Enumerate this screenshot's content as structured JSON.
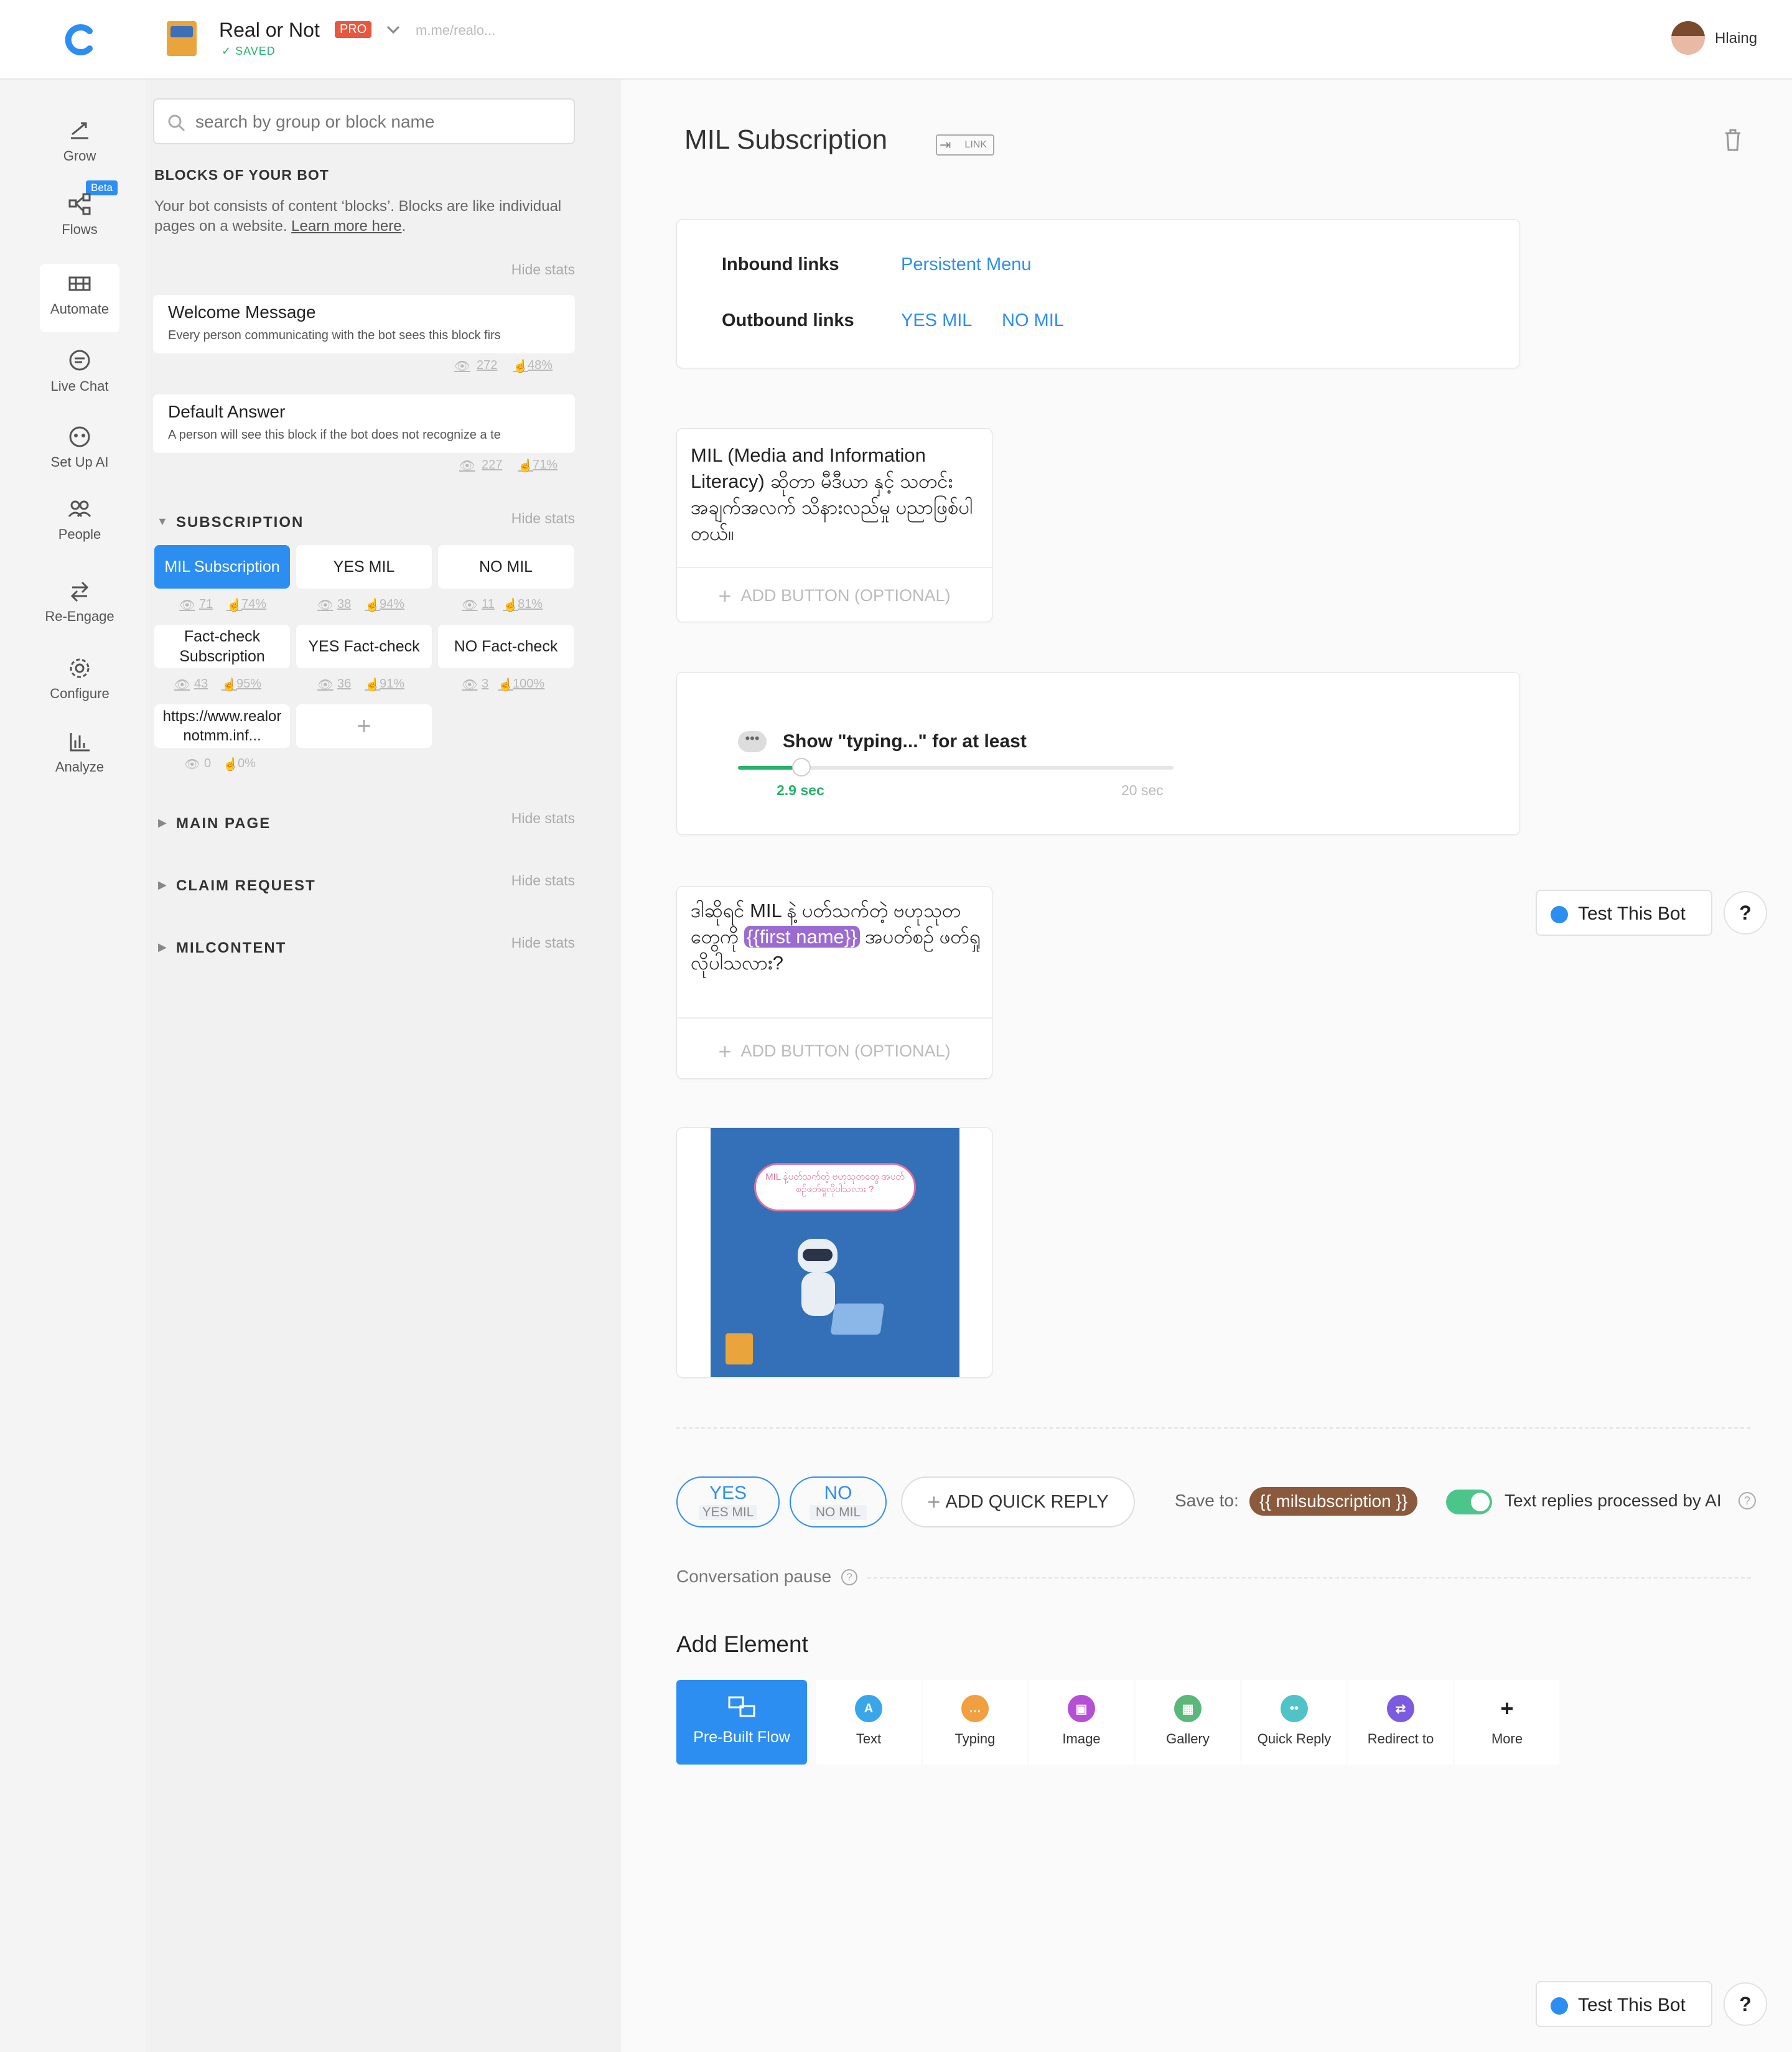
{
  "header": {
    "bot_name": "Real or Not",
    "pro_badge": "PRO",
    "saved": "SAVED",
    "bot_url": "m.me/realo...",
    "user_name": "Hlaing"
  },
  "nav": {
    "grow": "Grow",
    "flows": "Flows",
    "beta": "Beta",
    "automate": "Automate",
    "live_chat": "Live Chat",
    "setup_ai": "Set Up AI",
    "people": "People",
    "reengage": "Re-Engage",
    "configure": "Configure",
    "analyze": "Analyze"
  },
  "blocks": {
    "search_placeholder": "search by group or block name",
    "heading": "BLOCKS OF YOUR BOT",
    "desc": "Your bot consists of content ‘blocks’. Blocks are like individual pages on a website.",
    "learn_more": "Learn more here",
    "hide_stats": "Hide stats",
    "welcome": {
      "title": "Welcome Message",
      "desc": "Every person communicating with the bot sees this block firs",
      "views": "272",
      "clicks": "48%"
    },
    "default": {
      "title": "Default Answer",
      "desc": "A person will see this block if the bot does not recognize a te",
      "views": "227",
      "clicks": "71%"
    },
    "subscription_group": "SUBSCRIPTION",
    "chips": [
      {
        "label": "MIL Subscription",
        "views": "71",
        "clicks": "74%"
      },
      {
        "label": "YES MIL",
        "views": "38",
        "clicks": "94%"
      },
      {
        "label": "NO MIL",
        "views": "11",
        "clicks": "81%"
      },
      {
        "label": "Fact-check Subscription",
        "views": "43",
        "clicks": "95%"
      },
      {
        "label": "YES Fact-check",
        "views": "36",
        "clicks": "91%"
      },
      {
        "label": "NO Fact-check",
        "views": "3",
        "clicks": "100%"
      },
      {
        "label": "https://www.realornotmm.inf...",
        "views": "0",
        "clicks": "0%"
      }
    ],
    "groups": [
      "MAIN PAGE",
      "CLAIM REQUEST",
      "MILCONTENT"
    ]
  },
  "block": {
    "title": "MIL Subscription",
    "link_badge": "LINK",
    "inbound_label": "Inbound links",
    "inbound": [
      "Persistent Menu"
    ],
    "outbound_label": "Outbound links",
    "outbound": [
      "YES MIL",
      "NO MIL"
    ],
    "text1": "MIL (Media and Information Literacy) ဆိုတာ မီဒီယာ နှင့် သတင်းအချက်အလက် သိနားလည်မှု ပညာဖြစ်ပါတယ်။",
    "add_button": "ADD BUTTON (OPTIONAL)",
    "typing_label": "Show \"typing...\" for at least",
    "typing_value": "2.9 sec",
    "typing_max": "20 sec",
    "typing_fraction": 0.145,
    "text2_a": "ဒါဆိုရင် MIL နဲ့ ပတ်သက်တဲ့ ဗဟုသုတတွေကို",
    "text2_var": "{{first name}}",
    "text2_b": "အပတ်စဥ် ဖတ်ရှုလိုပါသလား?",
    "image_bubble": "MIL နဲ့ပတ်သက်တဲ့ ဗဟုသုတတွေ အပတ်စဥ်ဖတ်ရှုလိုပါသလား ?",
    "quick_replies": [
      {
        "label": "YES",
        "target": "YES MIL"
      },
      {
        "label": "NO",
        "target": "NO MIL"
      }
    ],
    "add_quick_reply": "ADD QUICK REPLY",
    "save_to": "Save to:",
    "save_var": "{{ milsubscription }}",
    "ai_toggle": "Text replies processed by AI",
    "pause": "Conversation pause",
    "add_element": "Add Element",
    "elements": [
      "Pre-Built Flow",
      "Text",
      "Typing",
      "Image",
      "Gallery",
      "Quick Reply",
      "Redirect to",
      "More"
    ]
  },
  "test_bot": "Test This Bot",
  "help": "?",
  "colors": {
    "accent": "#2d8ef2",
    "pro": "#e8573f",
    "saved": "#27b36b",
    "toggle": "#4cc58a",
    "variable": "#8b5a3c"
  }
}
